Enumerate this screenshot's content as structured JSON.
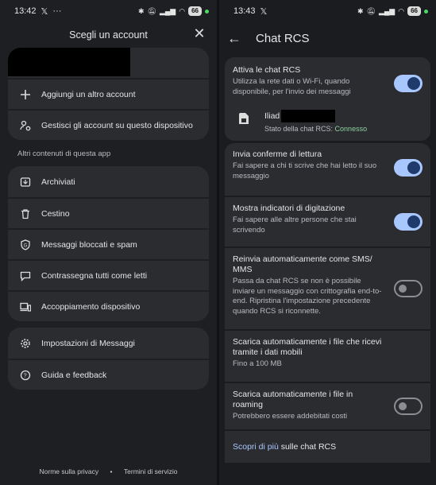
{
  "left": {
    "status": {
      "time": "13:42",
      "battery": "66"
    },
    "header": {
      "title": "Scegli un account"
    },
    "account_actions": [
      {
        "label": "Aggiungi un altro account",
        "icon": "plus-icon"
      },
      {
        "label": "Gestisci gli account su questo dispositivo",
        "icon": "manage-accounts-icon"
      }
    ],
    "section_label": "Altri contenuti di questa app",
    "menu_group1": [
      {
        "label": "Archiviati",
        "icon": "archive-icon"
      },
      {
        "label": "Cestino",
        "icon": "trash-icon"
      },
      {
        "label": "Messaggi bloccati e spam",
        "icon": "shield-icon"
      },
      {
        "label": "Contrassegna tutti come letti",
        "icon": "mark-read-icon"
      },
      {
        "label": "Accoppiamento dispositivo",
        "icon": "devices-icon"
      }
    ],
    "menu_group2": [
      {
        "label": "Impostazioni di Messaggi",
        "icon": "gear-icon"
      },
      {
        "label": "Guida e feedback",
        "icon": "help-icon"
      }
    ],
    "footer": {
      "privacy": "Norme sulla privacy",
      "sep": "•",
      "terms": "Termini di servizio"
    }
  },
  "right": {
    "status": {
      "time": "13:43",
      "battery": "66"
    },
    "title": "Chat RCS",
    "rcs": {
      "title": "Attiva le chat RCS",
      "desc": "Utilizza la rete dati o Wi-Fi, quando disponibile, per l'invio dei messaggi",
      "enabled": true
    },
    "sim": {
      "name": "Iliad",
      "status_label": "Stato della chat RCS: ",
      "status_value": "Connesso"
    },
    "settings": [
      {
        "title": "Invia conferme di lettura",
        "desc": "Fai sapere a chi ti scrive che hai letto il suo messaggio",
        "enabled": true
      },
      {
        "title": "Mostra indicatori di digitazione",
        "desc": "Fai sapere alle altre persone che stai scrivendo",
        "enabled": true
      },
      {
        "title": "Reinvia automaticamente come SMS/ MMS",
        "desc": "Passa da chat RCS se non è possibile inviare un messaggio con crittografia end-to-end. Ripristina l'impostazione precedente quando RCS si riconnette.",
        "enabled": false
      },
      {
        "title": "Scarica automaticamente i file che ricevi tramite i dati mobili",
        "desc": "Fino a 100 MB"
      },
      {
        "title": "Scarica automaticamente i file in roaming",
        "desc": "Potrebbero essere addebitati costi",
        "enabled": false
      }
    ],
    "learn_more": {
      "link": "Scopri di più",
      "rest": " sulle chat RCS"
    }
  },
  "colors": {
    "accent": "#a9c7ff",
    "connected": "#8dd3a0"
  }
}
